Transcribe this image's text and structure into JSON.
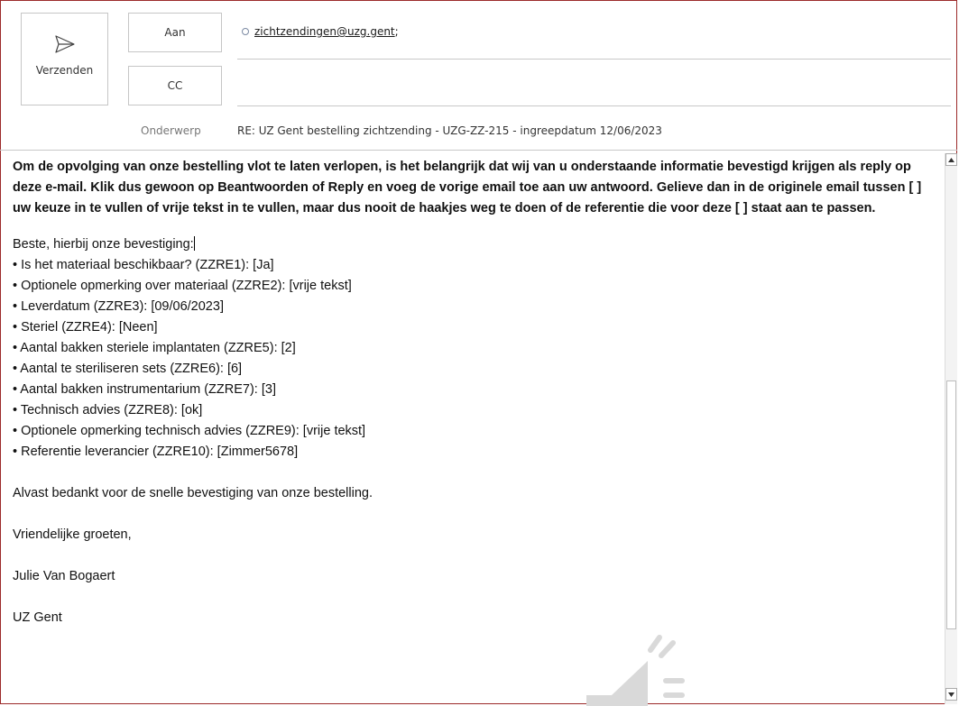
{
  "header": {
    "send_label": "Verzenden",
    "to_label": "Aan",
    "cc_label": "CC",
    "to_recipient": "zichtzendingen@uzg.gent",
    "to_separator": ";",
    "subject_label": "Onderwerp",
    "subject_value": "RE: UZ Gent bestelling zichtzending - UZG-ZZ-215 - ingreepdatum 12/06/2023"
  },
  "body": {
    "intro": "Om de opvolging van onze bestelling vlot te laten verlopen, is het belangrijk dat wij van u onderstaande informatie bevestigd krijgen als reply op deze e-mail. Klik dus gewoon op Beantwoorden of Reply en voeg de vorige email toe aan uw antwoord. Gelieve dan in de originele email tussen [ ] uw keuze in te vullen of vrije tekst in te vullen, maar dus nooit de haakjes weg te doen of de referentie die voor deze [ ] staat aan te passen.",
    "greeting": "Beste, hierbij onze bevestiging:",
    "items": [
      "• Is het materiaal beschikbaar? (ZZRE1): [Ja]",
      "• Optionele opmerking over materiaal (ZZRE2): [vrije tekst]",
      "• Leverdatum (ZZRE3): [09/06/2023]",
      "• Steriel (ZZRE4): [Neen]",
      "• Aantal bakken steriele implantaten (ZZRE5): [2]",
      "• Aantal te steriliseren sets (ZZRE6): [6]",
      "• Aantal bakken instrumentarium (ZZRE7): [3]",
      "• Technisch advies (ZZRE8): [ok]",
      "• Optionele opmerking technisch advies (ZZRE9): [vrije tekst]",
      "• Referentie leverancier (ZZRE10): [Zimmer5678]"
    ],
    "thanks": "Alvast bedankt voor de snelle bevestiging van onze bestelling.",
    "closing": "Vriendelijke groeten,",
    "signature_name": "Julie Van Bogaert",
    "signature_org": "UZ Gent"
  }
}
